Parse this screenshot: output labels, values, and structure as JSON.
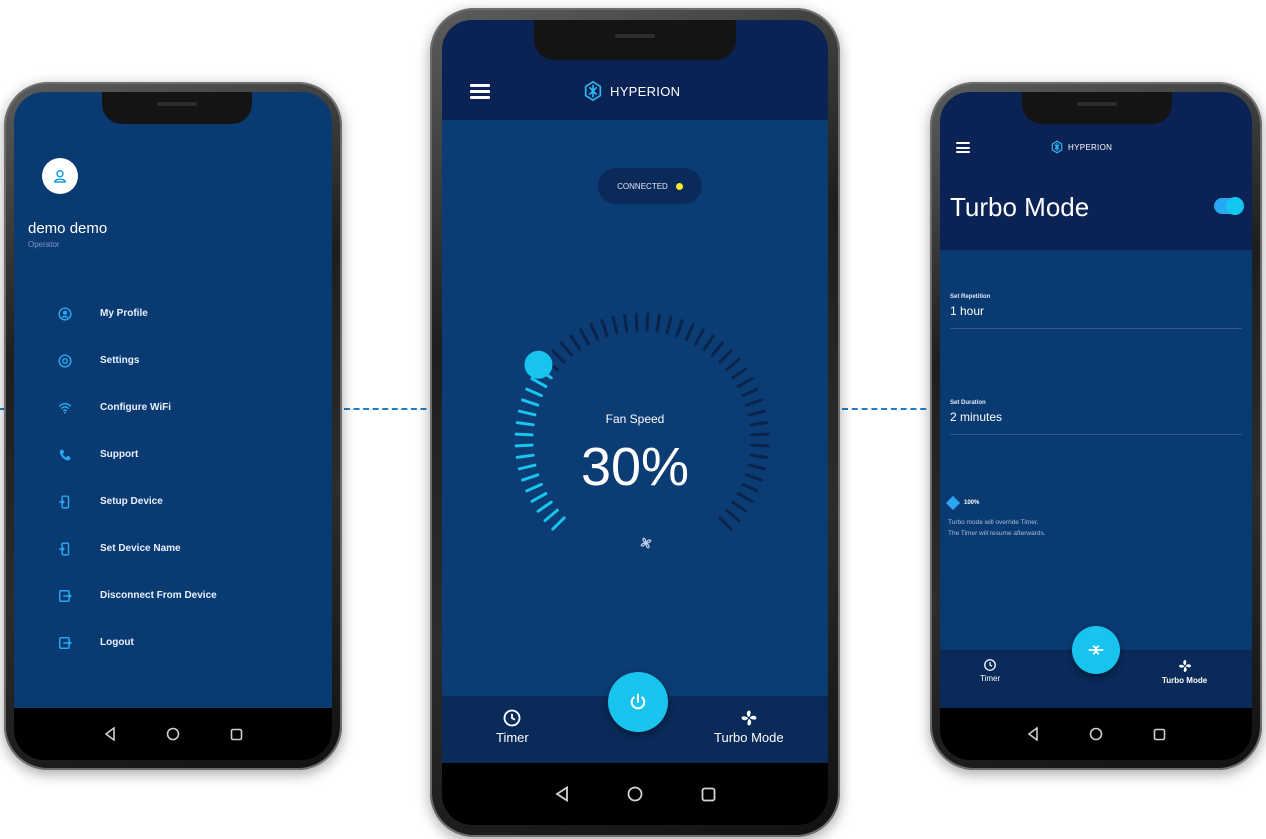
{
  "app": {
    "brand": "HYPERION",
    "accent_color": "#18c4ee",
    "dark_bar_color": "#0a2354",
    "main_bg_color": "#0c3c74",
    "status_dot_color": "#f3ea2a"
  },
  "menu_phone": {
    "user": {
      "name": "demo demo",
      "role": "Operator",
      "avatar_icon": "user-icon"
    },
    "items": [
      {
        "label": "My Profile",
        "icon": "profile-icon"
      },
      {
        "label": "Settings",
        "icon": "gear-icon"
      },
      {
        "label": "Configure WiFi",
        "icon": "wifi-icon"
      },
      {
        "label": "Support",
        "icon": "phone-icon"
      },
      {
        "label": "Setup Device",
        "icon": "device-icon"
      },
      {
        "label": "Set Device Name",
        "icon": "device-icon"
      },
      {
        "label": "Disconnect From Device",
        "icon": "exit-icon"
      },
      {
        "label": "Logout",
        "icon": "logout-icon"
      }
    ]
  },
  "fan_phone": {
    "status": "CONNECTED",
    "fan_speed_label": "Fan Speed",
    "fan_speed_value": "30%",
    "fan_speed_fraction": 0.3,
    "bottom": {
      "left_label": "Timer",
      "right_label": "Turbo Mode",
      "fab_icon": "power-icon"
    }
  },
  "turbo_phone": {
    "title": "Turbo Mode",
    "enabled": true,
    "repetition": {
      "label": "Set Repetition",
      "value": "1 hour"
    },
    "duration": {
      "label": "Set Duration",
      "value": "2 minutes"
    },
    "level": "100%",
    "note_line1": "Turbo mode will override Timer.",
    "note_line2": "The Timer will resume afterwards.",
    "bottom": {
      "left_label": "Timer",
      "right_label": "Turbo Mode",
      "fab_icon": "turbo-icon"
    }
  }
}
